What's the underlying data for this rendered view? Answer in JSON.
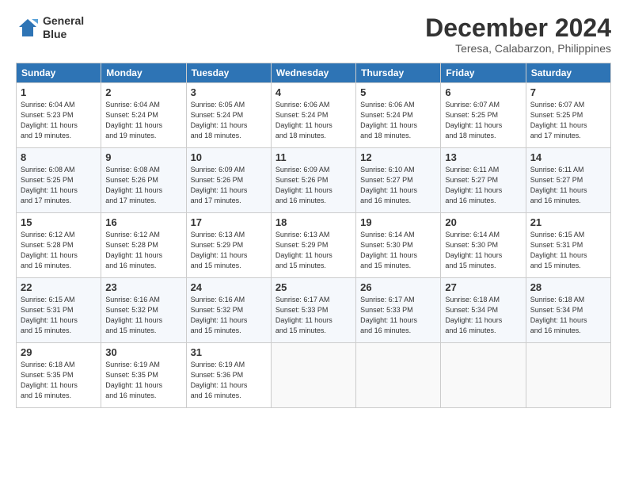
{
  "header": {
    "logo_line1": "General",
    "logo_line2": "Blue",
    "month_title": "December 2024",
    "location": "Teresa, Calabarzon, Philippines"
  },
  "weekdays": [
    "Sunday",
    "Monday",
    "Tuesday",
    "Wednesday",
    "Thursday",
    "Friday",
    "Saturday"
  ],
  "weeks": [
    [
      {
        "day": "1",
        "info": "Sunrise: 6:04 AM\nSunset: 5:23 PM\nDaylight: 11 hours\nand 19 minutes."
      },
      {
        "day": "2",
        "info": "Sunrise: 6:04 AM\nSunset: 5:24 PM\nDaylight: 11 hours\nand 19 minutes."
      },
      {
        "day": "3",
        "info": "Sunrise: 6:05 AM\nSunset: 5:24 PM\nDaylight: 11 hours\nand 18 minutes."
      },
      {
        "day": "4",
        "info": "Sunrise: 6:06 AM\nSunset: 5:24 PM\nDaylight: 11 hours\nand 18 minutes."
      },
      {
        "day": "5",
        "info": "Sunrise: 6:06 AM\nSunset: 5:24 PM\nDaylight: 11 hours\nand 18 minutes."
      },
      {
        "day": "6",
        "info": "Sunrise: 6:07 AM\nSunset: 5:25 PM\nDaylight: 11 hours\nand 18 minutes."
      },
      {
        "day": "7",
        "info": "Sunrise: 6:07 AM\nSunset: 5:25 PM\nDaylight: 11 hours\nand 17 minutes."
      }
    ],
    [
      {
        "day": "8",
        "info": "Sunrise: 6:08 AM\nSunset: 5:25 PM\nDaylight: 11 hours\nand 17 minutes."
      },
      {
        "day": "9",
        "info": "Sunrise: 6:08 AM\nSunset: 5:26 PM\nDaylight: 11 hours\nand 17 minutes."
      },
      {
        "day": "10",
        "info": "Sunrise: 6:09 AM\nSunset: 5:26 PM\nDaylight: 11 hours\nand 17 minutes."
      },
      {
        "day": "11",
        "info": "Sunrise: 6:09 AM\nSunset: 5:26 PM\nDaylight: 11 hours\nand 16 minutes."
      },
      {
        "day": "12",
        "info": "Sunrise: 6:10 AM\nSunset: 5:27 PM\nDaylight: 11 hours\nand 16 minutes."
      },
      {
        "day": "13",
        "info": "Sunrise: 6:11 AM\nSunset: 5:27 PM\nDaylight: 11 hours\nand 16 minutes."
      },
      {
        "day": "14",
        "info": "Sunrise: 6:11 AM\nSunset: 5:27 PM\nDaylight: 11 hours\nand 16 minutes."
      }
    ],
    [
      {
        "day": "15",
        "info": "Sunrise: 6:12 AM\nSunset: 5:28 PM\nDaylight: 11 hours\nand 16 minutes."
      },
      {
        "day": "16",
        "info": "Sunrise: 6:12 AM\nSunset: 5:28 PM\nDaylight: 11 hours\nand 16 minutes."
      },
      {
        "day": "17",
        "info": "Sunrise: 6:13 AM\nSunset: 5:29 PM\nDaylight: 11 hours\nand 15 minutes."
      },
      {
        "day": "18",
        "info": "Sunrise: 6:13 AM\nSunset: 5:29 PM\nDaylight: 11 hours\nand 15 minutes."
      },
      {
        "day": "19",
        "info": "Sunrise: 6:14 AM\nSunset: 5:30 PM\nDaylight: 11 hours\nand 15 minutes."
      },
      {
        "day": "20",
        "info": "Sunrise: 6:14 AM\nSunset: 5:30 PM\nDaylight: 11 hours\nand 15 minutes."
      },
      {
        "day": "21",
        "info": "Sunrise: 6:15 AM\nSunset: 5:31 PM\nDaylight: 11 hours\nand 15 minutes."
      }
    ],
    [
      {
        "day": "22",
        "info": "Sunrise: 6:15 AM\nSunset: 5:31 PM\nDaylight: 11 hours\nand 15 minutes."
      },
      {
        "day": "23",
        "info": "Sunrise: 6:16 AM\nSunset: 5:32 PM\nDaylight: 11 hours\nand 15 minutes."
      },
      {
        "day": "24",
        "info": "Sunrise: 6:16 AM\nSunset: 5:32 PM\nDaylight: 11 hours\nand 15 minutes."
      },
      {
        "day": "25",
        "info": "Sunrise: 6:17 AM\nSunset: 5:33 PM\nDaylight: 11 hours\nand 15 minutes."
      },
      {
        "day": "26",
        "info": "Sunrise: 6:17 AM\nSunset: 5:33 PM\nDaylight: 11 hours\nand 16 minutes."
      },
      {
        "day": "27",
        "info": "Sunrise: 6:18 AM\nSunset: 5:34 PM\nDaylight: 11 hours\nand 16 minutes."
      },
      {
        "day": "28",
        "info": "Sunrise: 6:18 AM\nSunset: 5:34 PM\nDaylight: 11 hours\nand 16 minutes."
      }
    ],
    [
      {
        "day": "29",
        "info": "Sunrise: 6:18 AM\nSunset: 5:35 PM\nDaylight: 11 hours\nand 16 minutes."
      },
      {
        "day": "30",
        "info": "Sunrise: 6:19 AM\nSunset: 5:35 PM\nDaylight: 11 hours\nand 16 minutes."
      },
      {
        "day": "31",
        "info": "Sunrise: 6:19 AM\nSunset: 5:36 PM\nDaylight: 11 hours\nand 16 minutes."
      },
      {
        "day": "",
        "info": ""
      },
      {
        "day": "",
        "info": ""
      },
      {
        "day": "",
        "info": ""
      },
      {
        "day": "",
        "info": ""
      }
    ]
  ]
}
